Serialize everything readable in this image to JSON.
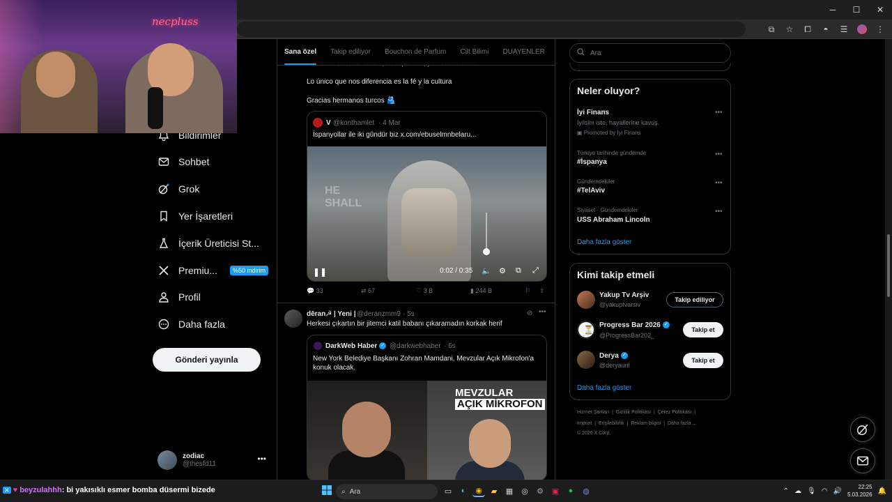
{
  "webcam": {
    "neon_text": "necpluss"
  },
  "browser": {
    "window_controls": [
      "─",
      "☐",
      "✕"
    ]
  },
  "nav": {
    "items": [
      {
        "label": "Bildirimler",
        "icon": "bell-icon"
      },
      {
        "label": "Sohbet",
        "icon": "mail-icon"
      },
      {
        "label": "Grok",
        "icon": "grok-icon"
      },
      {
        "label": "Yer İşaretleri",
        "icon": "bookmark-icon"
      },
      {
        "label": "İçerik Üreticisi St...",
        "icon": "flask-icon"
      },
      {
        "label": "Premiu...",
        "icon": "x-logo-icon",
        "badge": "%50 indirim"
      },
      {
        "label": "Profil",
        "icon": "person-icon"
      },
      {
        "label": "Daha fazla",
        "icon": "more-circle-icon"
      }
    ],
    "post_button": "Gönderi yayınla",
    "account": {
      "name": "zodiac",
      "handle": "@thesfd11"
    }
  },
  "tabs": [
    "Sana özel",
    "Takip ediliyor",
    "Bouchon de Parfum",
    "Cilt Bilimi",
    "DUAYENLER"
  ],
  "post1": {
    "cut_line": "Los turcos son más fuertes, los españoles, y los colonialistas",
    "line1": "Lo único que nos diferencia es la fé y la cultura",
    "line2": "Gracias hermanos turcos 🫂",
    "quote": {
      "name": "V",
      "handle": "@konthamlet",
      "time": "· 4 Mar",
      "text": "İspanyollar ile iki gündür biz  x.com/ebuselmnbelaru...",
      "video_time": "0:02 / 0:35",
      "video_overlay_text": "HE SHALL"
    },
    "actions": {
      "replies": "33",
      "reposts": "67",
      "likes": "3 B",
      "views": "244 B"
    }
  },
  "post2": {
    "name": "dēran☭ | Yeni |",
    "handle": "@deranzmm9",
    "time": "· 5s",
    "text": "Herkesi çıkartın bir jitemci katil babanı çıkaramadın korkak herif",
    "quote": {
      "name": "DarkWeb Haber",
      "handle": "@darkwebhaber",
      "time": "· 6s",
      "text": "New York Belediye Başkanı Zohran Mamdani, Mevzular Açık Mikrofon'a konuk olacak.",
      "image_text_1": "MEVZULAR",
      "image_text_2": "AÇIK MİKROFON"
    }
  },
  "right": {
    "search_placeholder": "Ara",
    "trends_title": "Neler oluyor?",
    "promo": {
      "name": "İyi Finans",
      "desc": "İyilsini iste, hayallerine kavuş.",
      "tag": "Promoted by İyi Finans"
    },
    "trends": [
      {
        "context": "Türkiye tarihinde gündemde",
        "name": "#İspanya"
      },
      {
        "context": "Gündemdekiler",
        "name": "#TelAviv"
      },
      {
        "context": "Siyaset · Gündemdekiler",
        "name": "USS Abraham Lincoln"
      }
    ],
    "show_more": "Daha fazla göster",
    "follow_title": "Kimi takip etmeli",
    "suggestions": [
      {
        "name": "Yakup Tv Arşiv",
        "handle": "@yakuptvarsiv",
        "button": "Takip ediliyor",
        "verified": false
      },
      {
        "name": "Progress Bar 2026",
        "handle": "@ProgressBar202_",
        "button": "Takip et",
        "verified": true
      },
      {
        "name": "Derya",
        "handle": "@deryauril",
        "button": "Takip et",
        "verified": true
      }
    ],
    "footer_line1": [
      "Hizmet Şartları",
      "Gizlilik Politikası",
      "Çerez Politikası"
    ],
    "footer_line2": [
      "Imprint",
      "Erişilebilirlik",
      "Reklam bilgisi",
      "Daha fazla ..."
    ],
    "copyright": "© 2026 X Corp."
  },
  "taskbar": {
    "chat_user": "beyzulahhh",
    "chat_text": ": bi yakısıklı esmer bomba düsermi bizede",
    "search_label": "Ara",
    "time": "22:25",
    "date": "5.03.2026"
  }
}
